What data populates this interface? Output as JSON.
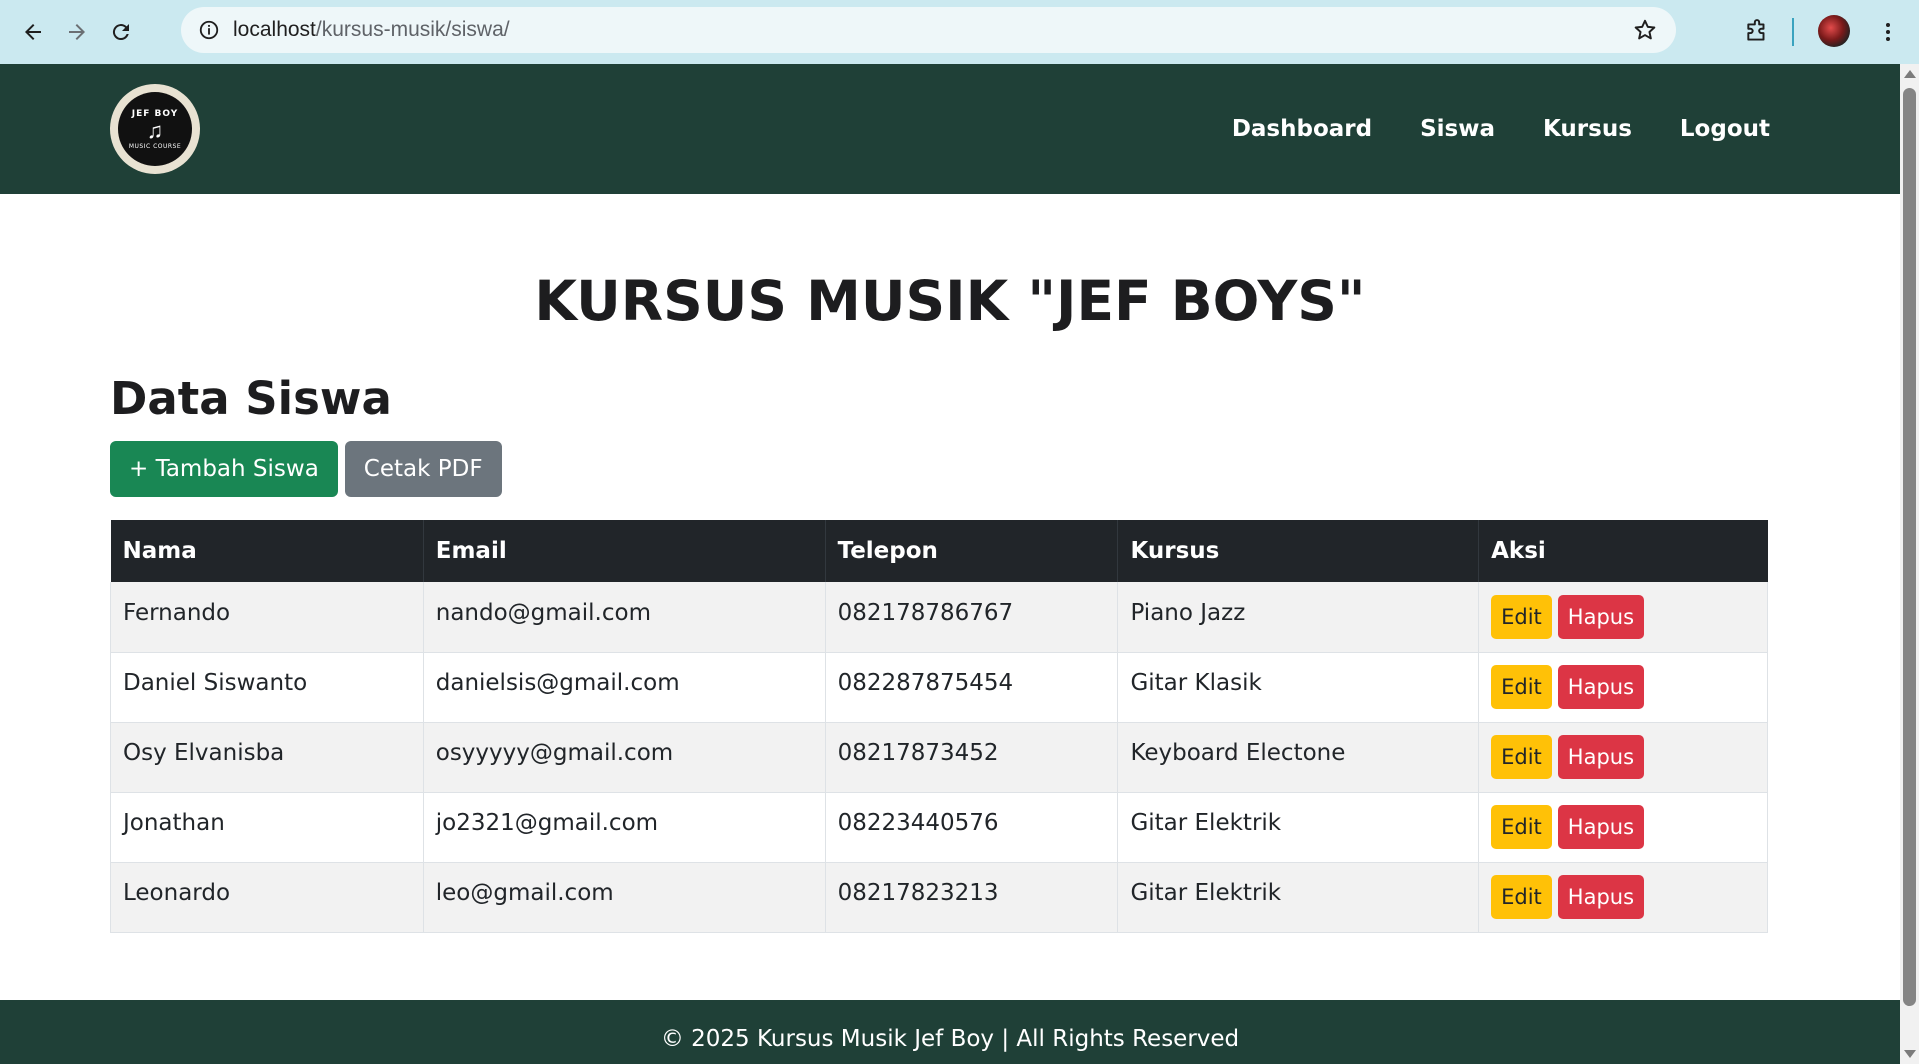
{
  "browser": {
    "url_host": "localhost",
    "url_path": "/kursus-musik/siswa/"
  },
  "site": {
    "logo": {
      "top": "JEF BOY",
      "bottom": "MUSIC COURSE"
    },
    "nav": [
      "Dashboard",
      "Siswa",
      "Kursus",
      "Logout"
    ]
  },
  "page": {
    "title": "KURSUS MUSIK \"JEF BOYS\"",
    "section_title": "Data Siswa",
    "add_button": "+ Tambah Siswa",
    "pdf_button": "Cetak PDF"
  },
  "table": {
    "headers": [
      "Nama",
      "Email",
      "Telepon",
      "Kursus",
      "Aksi"
    ],
    "rows": [
      {
        "nama": "Fernando",
        "email": "nando@gmail.com",
        "telepon": "082178786767",
        "kursus": "Piano Jazz"
      },
      {
        "nama": "Daniel Siswanto",
        "email": "danielsis@gmail.com",
        "telepon": "082287875454",
        "kursus": "Gitar Klasik"
      },
      {
        "nama": "Osy Elvanisba",
        "email": "osyyyyy@gmail.com",
        "telepon": "08217873452",
        "kursus": "Keyboard Electone"
      },
      {
        "nama": "Jonathan",
        "email": "jo2321@gmail.com",
        "telepon": "08223440576",
        "kursus": "Gitar Elektrik"
      },
      {
        "nama": "Leonardo",
        "email": "leo@gmail.com",
        "telepon": "08217823213",
        "kursus": "Gitar Elektrik"
      }
    ],
    "edit_label": "Edit",
    "delete_label": "Hapus"
  },
  "footer": {
    "text": "© 2025 Kursus Musik Jef Boy | All Rights Reserved"
  },
  "colors": {
    "navbar": "#1f4037",
    "success": "#198754",
    "secondary": "#6c757d",
    "warning": "#ffc107",
    "danger": "#dc3545",
    "table_header": "#212529"
  }
}
